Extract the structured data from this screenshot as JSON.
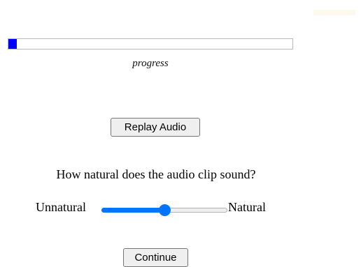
{
  "progress": {
    "label": "progress",
    "fraction": 0.03,
    "color": "#0000ff"
  },
  "replay_button": {
    "label": "Replay Audio"
  },
  "question": {
    "text": "How natural does the audio clip sound?"
  },
  "rating_slider": {
    "min_label": "Unnatural",
    "max_label": "Natural",
    "value_fraction": 0.5,
    "accent_color": "#0075ff"
  },
  "continue_button": {
    "label": "Continue"
  }
}
